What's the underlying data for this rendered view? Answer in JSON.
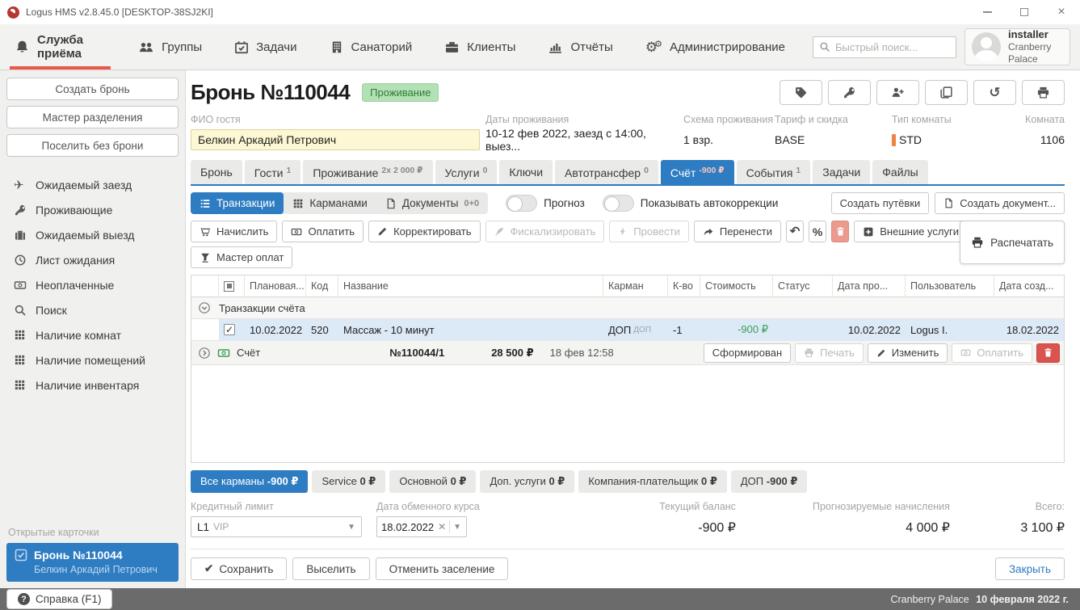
{
  "colors": {
    "accent_blue": "#2e7cc1",
    "accent_red": "#e8594a",
    "badge_green_bg": "#b3e0b4",
    "badge_green_text": "#2e7d36",
    "money_green": "#3d9e57",
    "room_type_orange": "#ef8440",
    "danger_red": "#d9534f"
  },
  "window": {
    "title": "Logus HMS v2.8.45.0 [DESKTOP-38SJ2KI]"
  },
  "nav": {
    "items": [
      {
        "label": "Служба приёма",
        "icon": "bell-icon",
        "active": true
      },
      {
        "label": "Группы",
        "icon": "users-icon"
      },
      {
        "label": "Задачи",
        "icon": "calendar-check-icon"
      },
      {
        "label": "Санаторий",
        "icon": "building-icon"
      },
      {
        "label": "Клиенты",
        "icon": "briefcase-icon"
      },
      {
        "label": "Отчёты",
        "icon": "bar-chart-icon"
      },
      {
        "label": "Администрирование",
        "icon": "gears-icon"
      }
    ],
    "search_placeholder": "Быстрый поиск...",
    "user": {
      "name": "installer",
      "org": "Cranberry Palace"
    }
  },
  "sidebar": {
    "buttons": [
      "Создать бронь",
      "Мастер разделения",
      "Поселить без брони"
    ],
    "items": [
      {
        "label": "Ожидаемый заезд",
        "icon": "plane-icon"
      },
      {
        "label": "Проживающие",
        "icon": "key-icon"
      },
      {
        "label": "Ожидаемый выезд",
        "icon": "suitcase-icon"
      },
      {
        "label": "Лист ожидания",
        "icon": "clock-icon"
      },
      {
        "label": "Неоплаченные",
        "icon": "banknote-icon"
      },
      {
        "label": "Поиск",
        "icon": "search-icon"
      },
      {
        "label": "Наличие комнат",
        "icon": "grid-icon"
      },
      {
        "label": "Наличие помещений",
        "icon": "grid-icon"
      },
      {
        "label": "Наличие инвентаря",
        "icon": "grid-icon"
      }
    ],
    "open_cards_label": "Открытые карточки",
    "open_card": {
      "title": "Бронь №110044",
      "subtitle": "Белкин Аркадий Петрович"
    }
  },
  "booking": {
    "title": "Бронь №110044",
    "status_badge": "Проживание",
    "fields": {
      "guest_label": "ФИО гостя",
      "guest_value": "Белкин Аркадий Петрович",
      "dates_label": "Даты проживания",
      "dates_value": "10-12 фев 2022, заезд с 14:00, выез...",
      "scheme_label": "Схема проживания",
      "scheme_value": "1 взр.",
      "tariff_label": "Тариф и скидка",
      "tariff_value": "BASE",
      "room_type_label": "Тип комнаты",
      "room_type_value": "STD",
      "room_label": "Комната",
      "room_value": "1106"
    }
  },
  "tabs": [
    {
      "label": "Бронь"
    },
    {
      "label": "Гости",
      "badge": "1"
    },
    {
      "label": "Проживание",
      "badge": "2x 2 000 ₽"
    },
    {
      "label": "Услуги",
      "badge": "0"
    },
    {
      "label": "Ключи"
    },
    {
      "label": "Автотрансфер",
      "badge": "0"
    },
    {
      "label": "Счёт",
      "badge": "-900 ₽",
      "active": true
    },
    {
      "label": "События",
      "badge": "1"
    },
    {
      "label": "Задачи"
    },
    {
      "label": "Файлы"
    }
  ],
  "account_toolbar": {
    "views": [
      {
        "label": "Транзакции",
        "icon": "list-icon",
        "active": true
      },
      {
        "label": "Карманами",
        "icon": "grid-icon"
      },
      {
        "label": "Документы",
        "badge": "0+0",
        "icon": "document-icon"
      }
    ],
    "toggles": [
      {
        "label": "Прогноз",
        "on": false
      },
      {
        "label": "Показывать автокоррекции",
        "on": false
      }
    ],
    "create_voucher": "Создать путёвки",
    "create_document": "Создать документ..."
  },
  "actions": {
    "charge": "Начислить",
    "pay": "Оплатить",
    "correct": "Корректировать",
    "fiscalize": "Фискализировать",
    "post": "Провести",
    "transfer": "Перенести",
    "percent": "%",
    "external": "Внешние услуги",
    "payment_master": "Мастер оплат",
    "print": "Распечатать"
  },
  "table": {
    "columns": [
      "Плановая...",
      "Код",
      "Название",
      "Карман",
      "К-во",
      "Стоимость",
      "Статус",
      "Дата про...",
      "Пользователь",
      "Дата созд..."
    ],
    "group_label": "Транзакции счёта",
    "rows": [
      {
        "planned": "10.02.2022",
        "code": "520",
        "name": "Массаж - 10 минут",
        "pocket": "ДОП",
        "pocket_sub": "ДОП",
        "qty": "-1",
        "cost": "-900 ₽",
        "status": "",
        "date_posted": "10.02.2022",
        "user": "Logus I.",
        "created": "18.02.2022",
        "checked": true
      }
    ],
    "invoice": {
      "type": "Счёт",
      "number": "№110044/1",
      "amount": "28 500 ₽",
      "datetime": "18 фев 12:58",
      "status": "Сформирован",
      "print": "Печать",
      "edit": "Изменить",
      "pay": "Оплатить"
    }
  },
  "pockets": [
    {
      "name": "Все карманы",
      "amount": "-900 ₽",
      "active": true
    },
    {
      "name": "Service",
      "amount": "0 ₽"
    },
    {
      "name": "Основной",
      "amount": "0 ₽"
    },
    {
      "name": "Доп. услуги",
      "amount": "0 ₽"
    },
    {
      "name": "Компания-плательщик",
      "amount": "0 ₽"
    },
    {
      "name": "ДОП",
      "amount": "-900 ₽"
    }
  ],
  "summary": {
    "credit_limit_label": "Кредитный лимит",
    "credit_limit_value": "L1",
    "credit_limit_tag": "VIP",
    "exchange_date_label": "Дата обменного курса",
    "exchange_date_value": "18.02.2022",
    "balance_label": "Текущий баланс",
    "balance_value": "-900 ₽",
    "forecast_label": "Прогнозируемые начисления",
    "forecast_value": "4 000 ₽",
    "total_label": "Всего:",
    "total_value": "3 100 ₽"
  },
  "footer": {
    "save": "Сохранить",
    "checkout": "Выселить",
    "cancel_checkin": "Отменить заселение",
    "close": "Закрыть"
  },
  "statusbar": {
    "help": "Справка (F1)",
    "org": "Cranberry Palace",
    "date": "10 февраля 2022 г."
  }
}
